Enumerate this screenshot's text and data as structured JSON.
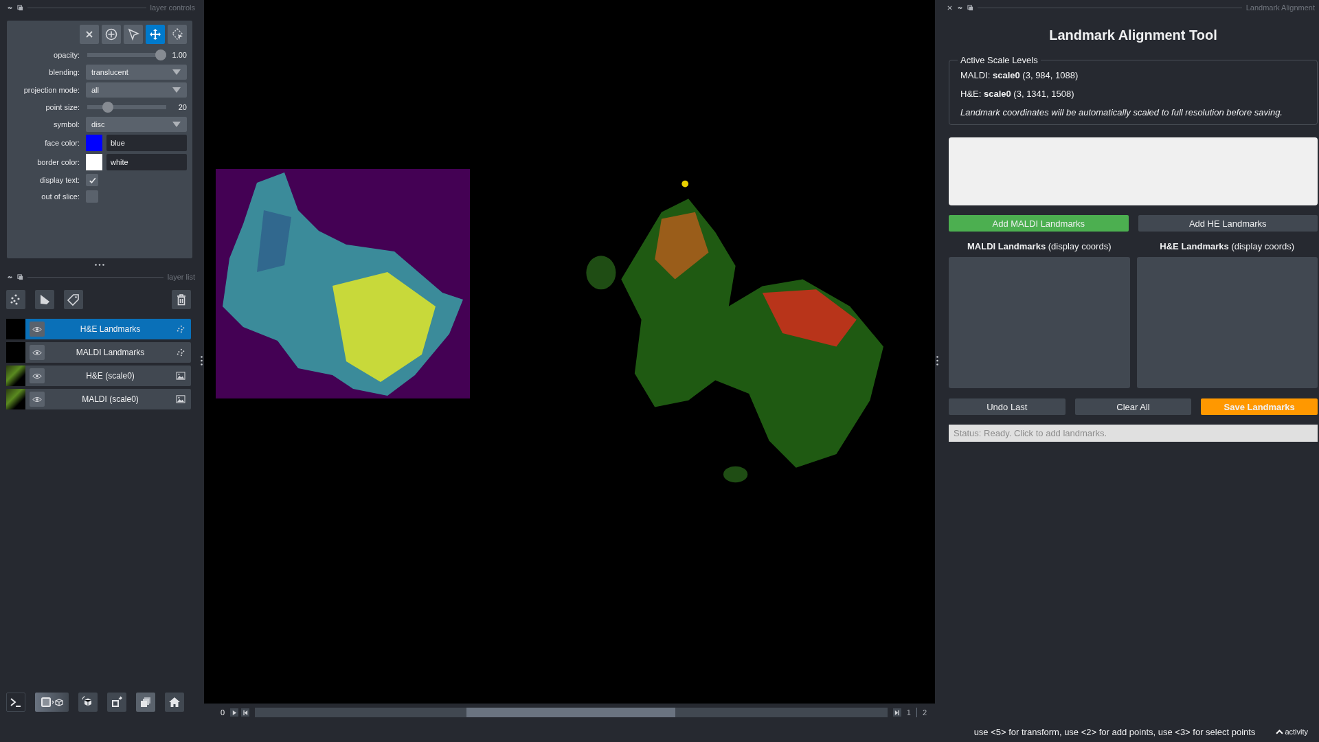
{
  "layer_controls": {
    "title": "layer controls",
    "mode_buttons": [
      {
        "kind": "delete",
        "selected": false
      },
      {
        "kind": "add",
        "selected": false
      },
      {
        "kind": "select",
        "selected": false
      },
      {
        "kind": "pan",
        "selected": true
      },
      {
        "kind": "lasso",
        "selected": false
      }
    ],
    "controls": [
      {
        "kind": "slider",
        "label": "opacity:",
        "level": 1.0,
        "reading": "1.00"
      },
      {
        "kind": "dropdown",
        "label": "blending:",
        "value": "translucent"
      },
      {
        "kind": "dropdown",
        "label": "projection mode:",
        "value": "all"
      },
      {
        "kind": "slider",
        "label": "point size:",
        "level": 0.22,
        "reading": "20"
      },
      {
        "kind": "dropdown",
        "label": "symbol:",
        "value": "disc"
      },
      {
        "kind": "color",
        "label": "face color:",
        "color": "#0000ff",
        "value": "blue"
      },
      {
        "kind": "color",
        "label": "border color:",
        "color": "#ffffff",
        "value": "white"
      },
      {
        "kind": "checkbox",
        "label": "display text:",
        "checked": true
      },
      {
        "kind": "checkbox",
        "label": "out of slice:",
        "checked": false
      }
    ]
  },
  "layer_list": {
    "title": "layer list",
    "layers": [
      {
        "name": "H&E Landmarks",
        "kind": "points",
        "selected": true,
        "visible": true
      },
      {
        "name": "MALDI Landmarks",
        "kind": "points",
        "selected": false,
        "visible": true
      },
      {
        "name": "H&E (scale0)",
        "kind": "image",
        "selected": false,
        "visible": true
      },
      {
        "name": "MALDI (scale0)",
        "kind": "image",
        "selected": false,
        "visible": true
      }
    ]
  },
  "dims": {
    "value": "0",
    "level": 0.5,
    "axis_labels": [
      "1",
      "2"
    ]
  },
  "dock": {
    "title": "Landmark Alignment",
    "heading": "Landmark Alignment Tool",
    "scale_group": {
      "title": "Active Scale Levels",
      "lines": [
        "MALDI: **scale0** (3, 984, 1088)",
        "H&E: **scale0** (3, 1341, 1508)"
      ],
      "note": "Landmark coordinates will be automatically scaled to full resolution before saving."
    },
    "add_buttons": [
      {
        "label": "Add MALDI Landmarks",
        "selected": true
      },
      {
        "label": "Add HE Landmarks",
        "selected": false
      }
    ],
    "lists": [
      {
        "heading": "**MALDI Landmarks** (display coords)"
      },
      {
        "heading": "**H&E Landmarks** (display coords)"
      }
    ],
    "actions": [
      {
        "label": "Undo Last",
        "kind": "normal"
      },
      {
        "label": "Clear All",
        "kind": "normal"
      },
      {
        "label": "Save Landmarks",
        "kind": "primary"
      }
    ],
    "status": "Status: Ready. Click to add landmarks."
  },
  "status_bar": {
    "hint": "use <5> for transform, use <2> for add points, use <3> for select points",
    "activity": "activity"
  }
}
